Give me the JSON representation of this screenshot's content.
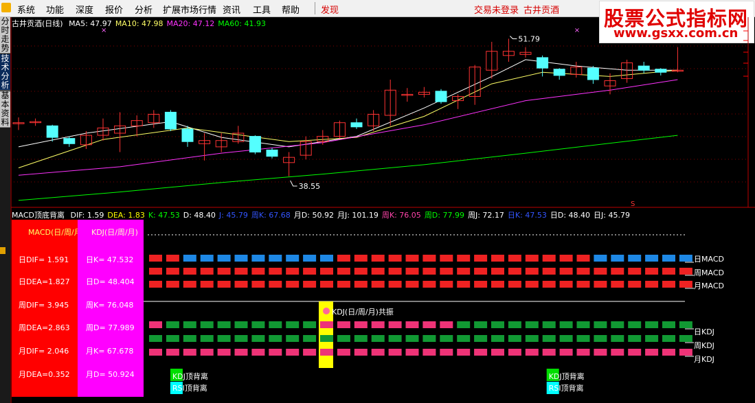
{
  "menu": {
    "items": [
      "系统",
      "功能",
      "深度",
      "报价",
      "分析",
      "扩展市场行情",
      "资讯",
      "工具",
      "帮助"
    ],
    "discover": "发现",
    "login_status": "交易未登录",
    "stock_name": "古井贡酒"
  },
  "watermark": {
    "title": "股票公式指标网",
    "url": "www.gsxx.com.cn"
  },
  "side_tabs": [
    "分时走势",
    "技术分析",
    "基本资料"
  ],
  "main_chart": {
    "title": "古井贡酒(日线)",
    "ma": [
      {
        "label": "MA5: 47.97",
        "color": "#ffffff"
      },
      {
        "label": "MA10: 47.98",
        "color": "#ffff66"
      },
      {
        "label": "MA20: 47.12",
        "color": "#ff33ff"
      },
      {
        "label": "MA60: 41.93",
        "color": "#00ff00"
      }
    ]
  },
  "sub_chart": {
    "title": "MACD顶底背离",
    "values": [
      {
        "label": "DIF: 1.59",
        "color": "#ffffff"
      },
      {
        "label": "DEA: 1.83",
        "color": "#ffff00"
      },
      {
        "label": "K: 47.53",
        "color": "#00ff00"
      },
      {
        "label": "D: 48.40",
        "color": "#ffffff"
      },
      {
        "label": "J: 45.79",
        "color": "#3355ff"
      },
      {
        "label": "周K: 67.68",
        "color": "#3355ff"
      },
      {
        "label": "月D: 50.92",
        "color": "#ffffff"
      },
      {
        "label": "月J: 101.19",
        "color": "#ffffff"
      },
      {
        "label": "周K: 76.05",
        "color": "#ff44aa"
      },
      {
        "label": "周D: 77.99",
        "color": "#00ff00"
      },
      {
        "label": "周J: 72.17",
        "color": "#ffffff"
      },
      {
        "label": "日K: 47.53",
        "color": "#3355ff"
      },
      {
        "label": "日D: 48.40",
        "color": "#ffffff"
      },
      {
        "label": "日J: 45.79",
        "color": "#ffffff"
      }
    ],
    "panel_red_title": "MACD(日/周/月)",
    "panel_red_rows": [
      "日DIF= 1.591",
      "日DEA=1.827",
      "周DIF= 3.945",
      "周DEA=2.863",
      "月DIF= 2.046",
      "月DEA=0.352"
    ],
    "panel_mag_title": "KDJ(日/周/月)",
    "panel_mag_rows": [
      "日K= 47.532",
      "日D= 48.404",
      "周K= 76.048",
      "周D= 77.989",
      "月K= 67.678",
      "月D= 50.924"
    ],
    "row_labels": [
      "日MACD",
      "周MACD",
      "月MACD",
      "日KDJ",
      "周KDJ",
      "月KDJ"
    ],
    "resonance_label": "KDJ(日/周/月)共振",
    "divergence_labels": [
      "KDJ顶背离",
      "RSI顶背离"
    ],
    "s_marker": "S"
  },
  "chart_data": {
    "type": "candlestick",
    "title": "古井贡酒(日线)",
    "y_range": [
      36,
      53
    ],
    "price_labels": [
      {
        "index": 29,
        "value": 51.79,
        "text": "51.79"
      },
      {
        "index": 16,
        "value": 38.55,
        "text": "38.55"
      }
    ],
    "candles": [
      {
        "o": 43.8,
        "c": 43.8,
        "h": 44.3,
        "l": 43.1
      },
      {
        "o": 43.9,
        "c": 43.9,
        "h": 44.2,
        "l": 43.5
      },
      {
        "o": 43.5,
        "c": 42.4,
        "h": 43.6,
        "l": 42.0
      },
      {
        "o": 42.3,
        "c": 41.8,
        "h": 42.5,
        "l": 41.5
      },
      {
        "o": 41.7,
        "c": 42.6,
        "h": 43.0,
        "l": 41.3
      },
      {
        "o": 42.6,
        "c": 43.3,
        "h": 44.2,
        "l": 42.1
      },
      {
        "o": 42.8,
        "c": 43.5,
        "h": 44.8,
        "l": 41.0
      },
      {
        "o": 43.5,
        "c": 44.0,
        "h": 44.5,
        "l": 42.5
      },
      {
        "o": 43.8,
        "c": 44.6,
        "h": 45.0,
        "l": 43.3
      },
      {
        "o": 44.8,
        "c": 43.2,
        "h": 45.0,
        "l": 43.0
      },
      {
        "o": 43.2,
        "c": 42.0,
        "h": 43.5,
        "l": 41.5
      },
      {
        "o": 41.8,
        "c": 42.1,
        "h": 42.8,
        "l": 40.2
      },
      {
        "o": 41.5,
        "c": 42.1,
        "h": 42.8,
        "l": 41.0
      },
      {
        "o": 42.0,
        "c": 42.8,
        "h": 43.5,
        "l": 41.8
      },
      {
        "o": 42.5,
        "c": 41.0,
        "h": 42.6,
        "l": 40.8
      },
      {
        "o": 41.2,
        "c": 40.6,
        "h": 41.4,
        "l": 40.4
      },
      {
        "o": 40.0,
        "c": 40.5,
        "h": 41.0,
        "l": 38.7
      },
      {
        "o": 40.7,
        "c": 42.0,
        "h": 42.5,
        "l": 40.3
      },
      {
        "o": 42.0,
        "c": 42.5,
        "h": 43.1,
        "l": 41.7
      },
      {
        "o": 42.5,
        "c": 43.8,
        "h": 44.0,
        "l": 42.3
      },
      {
        "o": 43.8,
        "c": 43.4,
        "h": 44.2,
        "l": 43.2
      },
      {
        "o": 43.5,
        "c": 44.6,
        "h": 45.0,
        "l": 43.0
      },
      {
        "o": 44.5,
        "c": 46.9,
        "h": 47.9,
        "l": 43.5
      },
      {
        "o": 46.5,
        "c": 46.5,
        "h": 47.1,
        "l": 45.8
      },
      {
        "o": 46.5,
        "c": 46.7,
        "h": 47.2,
        "l": 46.2
      },
      {
        "o": 46.8,
        "c": 45.8,
        "h": 47.0,
        "l": 45.6
      },
      {
        "o": 45.9,
        "c": 46.3,
        "h": 46.5,
        "l": 45.1
      },
      {
        "o": 46.3,
        "c": 49.1,
        "h": 49.3,
        "l": 45.5
      },
      {
        "o": 48.8,
        "c": 50.6,
        "h": 51.5,
        "l": 48.0
      },
      {
        "o": 50.2,
        "c": 50.6,
        "h": 51.8,
        "l": 49.6
      },
      {
        "o": 50.3,
        "c": 50.5,
        "h": 51.0,
        "l": 50.0
      },
      {
        "o": 50.0,
        "c": 49.0,
        "h": 50.2,
        "l": 48.2
      },
      {
        "o": 48.9,
        "c": 48.3,
        "h": 49.0,
        "l": 47.9
      },
      {
        "o": 48.4,
        "c": 49.1,
        "h": 49.6,
        "l": 48.1
      },
      {
        "o": 49.0,
        "c": 47.9,
        "h": 49.2,
        "l": 47.5
      },
      {
        "o": 47.3,
        "c": 47.8,
        "h": 48.5,
        "l": 46.5
      },
      {
        "o": 48.0,
        "c": 49.5,
        "h": 49.8,
        "l": 47.6
      },
      {
        "o": 49.2,
        "c": 48.8,
        "h": 49.6,
        "l": 48.5
      },
      {
        "o": 48.9,
        "c": 48.6,
        "h": 49.0,
        "l": 48.3
      },
      {
        "o": 48.8,
        "c": 48.8,
        "h": 51.0,
        "l": 48.6
      }
    ],
    "ma_series": [
      {
        "name": "MA5",
        "color": "#ffffff",
        "points": [
          [
            0,
            41.5
          ],
          [
            4,
            42.8
          ],
          [
            9,
            43.9
          ],
          [
            12,
            42.4
          ],
          [
            16,
            41.5
          ],
          [
            20,
            42.5
          ],
          [
            24,
            45.2
          ],
          [
            28,
            48.2
          ],
          [
            30,
            49.8
          ],
          [
            33,
            49.2
          ],
          [
            36,
            48.8
          ],
          [
            39,
            48.8
          ]
        ]
      },
      {
        "name": "MA10",
        "color": "#ffff66",
        "points": [
          [
            0,
            39.5
          ],
          [
            5,
            42.2
          ],
          [
            10,
            43.3
          ],
          [
            16,
            42.0
          ],
          [
            20,
            42.4
          ],
          [
            24,
            44.4
          ],
          [
            28,
            47.5
          ],
          [
            31,
            48.6
          ],
          [
            35,
            48.2
          ],
          [
            39,
            48.8
          ]
        ]
      },
      {
        "name": "MA20",
        "color": "#ff33ff",
        "points": [
          [
            0,
            38.8
          ],
          [
            6,
            39.6
          ],
          [
            12,
            40.9
          ],
          [
            18,
            41.9
          ],
          [
            24,
            43.6
          ],
          [
            30,
            45.9
          ],
          [
            35,
            46.9
          ],
          [
            39,
            47.9
          ]
        ]
      },
      {
        "name": "MA60",
        "color": "#00ff00",
        "points": [
          [
            0,
            36.4
          ],
          [
            6,
            37.2
          ],
          [
            12,
            38.1
          ],
          [
            18,
            38.9
          ],
          [
            24,
            39.8
          ],
          [
            30,
            40.9
          ],
          [
            39,
            42.6
          ]
        ]
      }
    ],
    "indicator_rows": {
      "columns": 32,
      "daily_macd": "rrbbbbbbbbbrrrrrrrrrrrrrrrbbbbbb",
      "weekly_macd": "rrrrrrrrrrrrrrrrrrrrrrrrrrrrrrrr",
      "monthly_macd": "rrrrrrrrrrrrrrrrrrrrrrrrrrrrrrrr",
      "daily_kdj": "pgggggggggppppppppgggggggggggggg",
      "weekly_kdj": "gggggggggggggggggggggggggggggggg",
      "monthly_kdj": "pppppppppppppppppppppppppppppppp",
      "resonance_column": 10,
      "divergence_columns": [
        1,
        23
      ]
    }
  }
}
